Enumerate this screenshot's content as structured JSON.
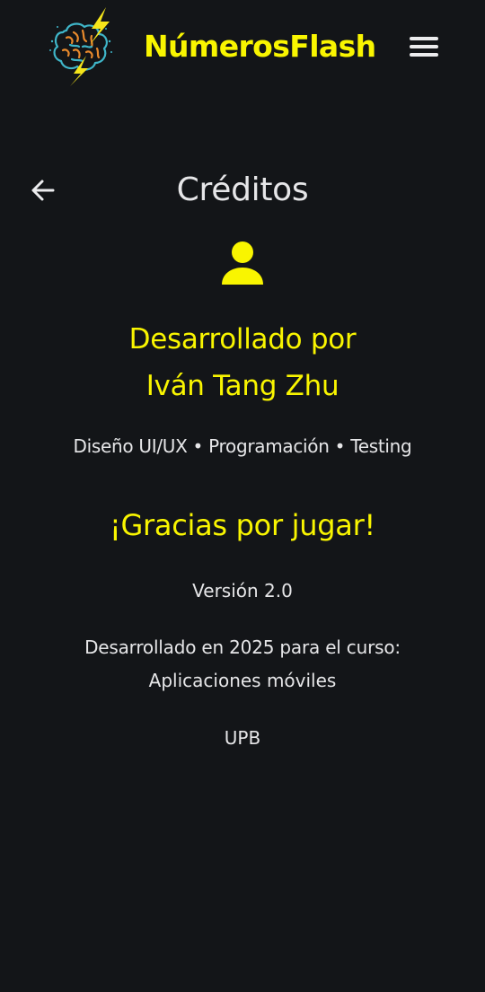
{
  "header": {
    "app_title": "NúmerosFlash",
    "logo_icon": "brain-lightning-logo",
    "menu_icon": "hamburger-menu-icon"
  },
  "page": {
    "title": "Créditos",
    "back_icon": "arrow-left-icon",
    "person_icon": "person-icon"
  },
  "credits": {
    "developed_by_label": "Desarrollado por",
    "developer_name": "Iván Tang Zhu",
    "roles": "Diseño UI/UX • Programación • Testing",
    "thanks": "¡Gracias por jugar!",
    "version": "Versión 2.0",
    "course_line_1": "Desarrollado en 2025 para el curso:",
    "course_line_2": "Aplicaciones móviles",
    "university": "UPB"
  },
  "colors": {
    "background": "#131518",
    "accent": "#f9f500",
    "text": "#e6e6e8"
  }
}
